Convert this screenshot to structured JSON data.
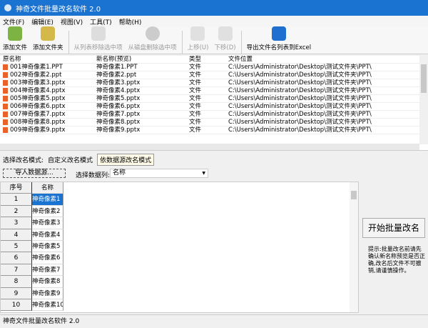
{
  "title": "神奇文件批量改名软件 2.0",
  "menu": [
    "文件(F)",
    "编辑(E)",
    "视图(V)",
    "工具(T)",
    "帮助(H)"
  ],
  "toolbar": {
    "add_file": "添加文件",
    "add_folder": "添加文件夹",
    "remove": "从列表移除选中项",
    "delete": "从磁盘删除选中项",
    "up": "上移(U)",
    "down": "下移(D)",
    "export": "导出文件名列表到Excel"
  },
  "columns": [
    "原名称",
    "新名称(预览)",
    "类型",
    "文件位置"
  ],
  "rows": [
    {
      "orig": "001神奇像素1.PPT",
      "new": "神奇像素1.PPT",
      "type": "文件",
      "path": "C:\\Users\\Administrator\\Desktop\\测试文件夹\\PPT\\"
    },
    {
      "orig": "002神奇像素2.ppt",
      "new": "神奇像素2.ppt",
      "type": "文件",
      "path": "C:\\Users\\Administrator\\Desktop\\测试文件夹\\PPT\\"
    },
    {
      "orig": "003神奇像素3.pptx",
      "new": "神奇像素3.pptx",
      "type": "文件",
      "path": "C:\\Users\\Administrator\\Desktop\\测试文件夹\\PPT\\"
    },
    {
      "orig": "004神奇像素4.pptx",
      "new": "神奇像素4.pptx",
      "type": "文件",
      "path": "C:\\Users\\Administrator\\Desktop\\测试文件夹\\PPT\\"
    },
    {
      "orig": "005神奇像素5.pptx",
      "new": "神奇像素5.pptx",
      "type": "文件",
      "path": "C:\\Users\\Administrator\\Desktop\\测试文件夹\\PPT\\"
    },
    {
      "orig": "006神奇像素6.pptx",
      "new": "神奇像素6.pptx",
      "type": "文件",
      "path": "C:\\Users\\Administrator\\Desktop\\测试文件夹\\PPT\\"
    },
    {
      "orig": "007神奇像素7.pptx",
      "new": "神奇像素7.pptx",
      "type": "文件",
      "path": "C:\\Users\\Administrator\\Desktop\\测试文件夹\\PPT\\"
    },
    {
      "orig": "008神奇像素8.pptx",
      "new": "神奇像素8.pptx",
      "type": "文件",
      "path": "C:\\Users\\Administrator\\Desktop\\测试文件夹\\PPT\\"
    },
    {
      "orig": "009神奇像素9.pptx",
      "new": "神奇像素9.pptx",
      "type": "文件",
      "path": "C:\\Users\\Administrator\\Desktop\\测试文件夹\\PPT\\"
    }
  ],
  "mode": {
    "label": "选择改名模式:",
    "custom": "自定义改名模式",
    "datasource": "依数据源改名模式"
  },
  "import_button": "导入数据源...",
  "column_label": "选择数据列:",
  "column_value": "名称",
  "grid": {
    "headers": [
      "序号",
      "名称"
    ],
    "rows": [
      [
        "1",
        "神奇像素1"
      ],
      [
        "2",
        "神奇像素2"
      ],
      [
        "3",
        "神奇像素3"
      ],
      [
        "4",
        "神奇像素4"
      ],
      [
        "5",
        "神奇像素5"
      ],
      [
        "6",
        "神奇像素6"
      ],
      [
        "7",
        "神奇像素7"
      ],
      [
        "8",
        "神奇像素8"
      ],
      [
        "9",
        "神奇像素9"
      ],
      [
        "10",
        "神奇像素10"
      ]
    ]
  },
  "start_button": "开始批量改名",
  "note": "提示:批量改名前请先确认新名称预览是否正确,改名后文件不可撤销,请谨慎操作。",
  "status": "神奇文件批量改名软件 2.0"
}
